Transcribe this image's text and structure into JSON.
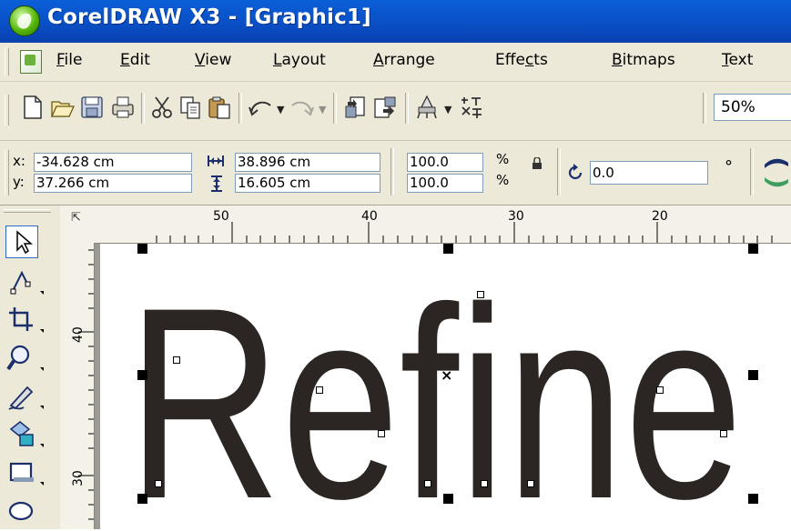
{
  "window": {
    "title": "CorelDRAW X3 - [Graphic1]"
  },
  "menu": {
    "items": [
      "File",
      "Edit",
      "View",
      "Layout",
      "Arrange",
      "Effects",
      "Bitmaps",
      "Text"
    ]
  },
  "toolbar": {
    "icons": [
      "new-icon",
      "open-icon",
      "save-icon",
      "print-icon",
      "cut-icon",
      "copy-icon",
      "paste-icon",
      "undo-icon",
      "redo-icon",
      "import-icon",
      "export-icon",
      "application-launcher-icon",
      "welcome-screen-icon"
    ],
    "zoom": "50%"
  },
  "property_bar": {
    "x_label": "x:",
    "x_value": "-34.628 cm",
    "y_label": "y:",
    "y_value": "37.266 cm",
    "width_value": "38.896 cm",
    "height_value": "16.605 cm",
    "scale_x": "100.0",
    "scale_y": "100.0",
    "percent_top": "%",
    "percent_bottom": "%",
    "rotation": "0.0",
    "degree": "°"
  },
  "ruler": {
    "h_labels": [
      "50",
      "40",
      "30",
      "20"
    ],
    "v_labels": [
      "40",
      "30"
    ]
  },
  "canvas": {
    "text": "Refine",
    "text_color": "#2b2624"
  },
  "colors": {
    "titlebar": "#0a4fc6",
    "chrome": "#ece9d8"
  }
}
